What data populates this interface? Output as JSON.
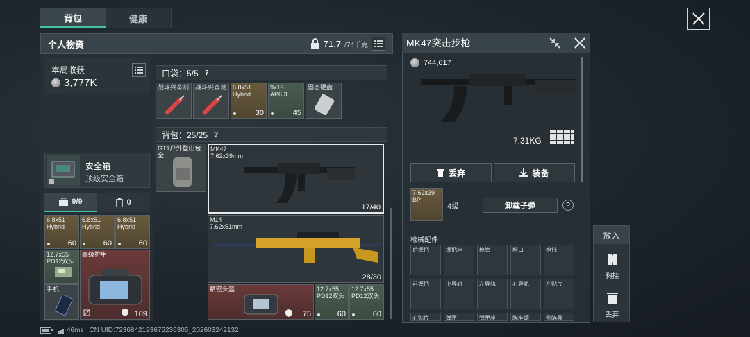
{
  "tabs": [
    {
      "label": "背包"
    },
    {
      "label": "健康"
    }
  ],
  "inventory": {
    "title": "个人物资",
    "weight": "71.7",
    "weight_max": "/74千克"
  },
  "earnings": {
    "label": "本局收获",
    "value": "3,777K"
  },
  "safe_box": {
    "name": "安全箱",
    "subtitle": "顶级安全箱"
  },
  "storage_tabs": [
    {
      "label": "9/9"
    },
    {
      "label": "0"
    }
  ],
  "pocket": {
    "label": "口袋：5/5",
    "help": "?"
  },
  "pocket_items": [
    {
      "title": "战斗兴奋剂",
      "count": ""
    },
    {
      "title": "战斗兴奋剂",
      "count": ""
    },
    {
      "title": "6.8x51\nHybrid",
      "count": "30"
    },
    {
      "title": "9x19\nAP6.3",
      "count": "45"
    },
    {
      "title": "固态硬盘",
      "count": ""
    }
  ],
  "backpack": {
    "label": "背包：25/25",
    "help": "?",
    "name": "GT1户外登山包",
    "name_short": "全..."
  },
  "weapons": [
    {
      "name": "MK47",
      "caliber": "7.62x39mm",
      "ammo": "17/40"
    },
    {
      "name": "M14",
      "caliber": "7.62x51mm",
      "ammo": "28/30"
    }
  ],
  "backpack_items": [
    {
      "title": "精密头盔",
      "count": "75"
    },
    {
      "title": "12.7x55\nPD12双头",
      "count": "60"
    },
    {
      "title": "12.7x55\nPD12双头",
      "count": "60"
    }
  ],
  "left_items": [
    {
      "title": "6.8x51\nHybrid",
      "count": "60"
    },
    {
      "title": "6.8x51\nHybrid",
      "count": "60"
    },
    {
      "title": "6.8x51\nHybrid",
      "count": "60"
    },
    {
      "title": "12.7x55\nPD12双头",
      "count": ""
    },
    {
      "title": "高级护甲",
      "count": ""
    },
    {
      "title": "手机",
      "count": ""
    }
  ],
  "vest_count": "109",
  "detail": {
    "title": "MK47突击步枪",
    "value": "744,617",
    "weight": "7.31KG",
    "discard": "丢弃",
    "equip": "装备",
    "ammo": {
      "title": "7.62x39\nBP",
      "level": "4级"
    },
    "unload": "卸载子弹",
    "help": "?",
    "attachments_label": "枪械配件",
    "slots": [
      "后握把",
      "握把座",
      "枪管",
      "枪口",
      "枪托",
      "前握把",
      "上导轨",
      "左导轨",
      "右导轨",
      "左贴片",
      "右贴片",
      "弹匣",
      "弹匣座",
      "瞄准镜",
      "侧瞄具"
    ]
  },
  "side_actions": {
    "put": "放入",
    "vest": "胸挂",
    "discard": "丢弃"
  },
  "status": {
    "ping": "46ms",
    "uid": "CN UID:7236842193675236305_202603242132"
  }
}
